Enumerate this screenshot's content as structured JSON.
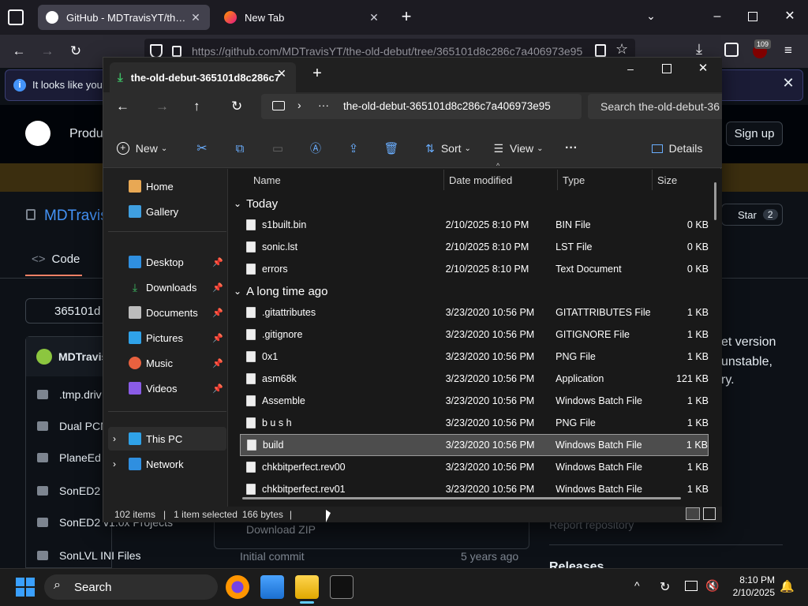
{
  "browser": {
    "tabs": [
      {
        "label": "GitHub - MDTravisYT/the-old-d",
        "active": true
      },
      {
        "label": "New Tab",
        "active": false
      }
    ],
    "url": "https://github.com/MDTravisYT/the-old-debut/tree/365101d8c286c7a406973e95",
    "extension_badge": "109"
  },
  "github": {
    "info_text": "It looks like you h",
    "nav_product": "Produ",
    "sign_up": "Sign up",
    "repo_owner": "MDTravis",
    "tab_code": "Code",
    "star_label": "Star",
    "star_count": "2",
    "branch": "365101d",
    "commit_author": "MDTravis",
    "sidebar_text": [
      "et version",
      "unstable,",
      "ry."
    ],
    "files": [
      ".tmp.driv",
      "Dual PCN",
      "PlaneEd I",
      "SonED2 I",
      "SonED2 v1.0x Projects",
      "SonLVL INI Files"
    ],
    "download_zip": "Download ZIP",
    "report_repository": "Report repository",
    "initial_commit": "Initial commit",
    "commit_age": "5 years ago",
    "releases": "Releases"
  },
  "explorer": {
    "tab_title": "the-old-debut-365101d8c286c7",
    "breadcrumb": "the-old-debut-365101d8c286c7a406973e95",
    "search_placeholder": "Search the-old-debut-36",
    "commands": {
      "new": "New",
      "sort": "Sort",
      "view": "View",
      "details": "Details",
      "more": "···"
    },
    "sidebar": [
      {
        "label": "Home",
        "icon": "home-icon",
        "pinned": false
      },
      {
        "label": "Gallery",
        "icon": "gallery-icon",
        "pinned": false
      },
      {
        "label": "Desktop",
        "icon": "desktop-icon",
        "pinned": true
      },
      {
        "label": "Downloads",
        "icon": "downloads-icon",
        "pinned": true
      },
      {
        "label": "Documents",
        "icon": "documents-icon",
        "pinned": true
      },
      {
        "label": "Pictures",
        "icon": "pictures-icon",
        "pinned": true
      },
      {
        "label": "Music",
        "icon": "music-icon",
        "pinned": true
      },
      {
        "label": "Videos",
        "icon": "videos-icon",
        "pinned": true
      },
      {
        "label": "This PC",
        "icon": "this-pc-icon",
        "pinned": false
      },
      {
        "label": "Network",
        "icon": "network-icon",
        "pinned": false
      }
    ],
    "columns": {
      "name": "Name",
      "date": "Date modified",
      "type": "Type",
      "size": "Size"
    },
    "groups": [
      "Today",
      "A long time ago"
    ],
    "files_today": [
      {
        "name": "s1built.bin",
        "date": "2/10/2025 8:10 PM",
        "type": "BIN File",
        "size": "0 KB"
      },
      {
        "name": "sonic.lst",
        "date": "2/10/2025 8:10 PM",
        "type": "LST File",
        "size": "0 KB"
      },
      {
        "name": "errors",
        "date": "2/10/2025 8:10 PM",
        "type": "Text Document",
        "size": "0 KB"
      }
    ],
    "files_old": [
      {
        "name": ".gitattributes",
        "date": "3/23/2020 10:56 PM",
        "type": "GITATTRIBUTES File",
        "size": "1 KB"
      },
      {
        "name": ".gitignore",
        "date": "3/23/2020 10:56 PM",
        "type": "GITIGNORE File",
        "size": "1 KB"
      },
      {
        "name": "0x1",
        "date": "3/23/2020 10:56 PM",
        "type": "PNG File",
        "size": "1 KB"
      },
      {
        "name": "asm68k",
        "date": "3/23/2020 10:56 PM",
        "type": "Application",
        "size": "121 KB"
      },
      {
        "name": "Assemble",
        "date": "3/23/2020 10:56 PM",
        "type": "Windows Batch File",
        "size": "1 KB"
      },
      {
        "name": "b u s h",
        "date": "3/23/2020 10:56 PM",
        "type": "PNG File",
        "size": "1 KB"
      },
      {
        "name": "build",
        "date": "3/23/2020 10:56 PM",
        "type": "Windows Batch File",
        "size": "1 KB",
        "selected": true
      },
      {
        "name": "chkbitperfect.rev00",
        "date": "3/23/2020 10:56 PM",
        "type": "Windows Batch File",
        "size": "1 KB"
      },
      {
        "name": "chkbitperfect.rev01",
        "date": "3/23/2020 10:56 PM",
        "type": "Windows Batch File",
        "size": "1 KB"
      }
    ],
    "status": {
      "items": "102 items",
      "selected": "1 item selected",
      "size": "166 bytes"
    }
  },
  "taskbar": {
    "search": "Search",
    "time": "8:10 PM",
    "date": "2/10/2025"
  }
}
